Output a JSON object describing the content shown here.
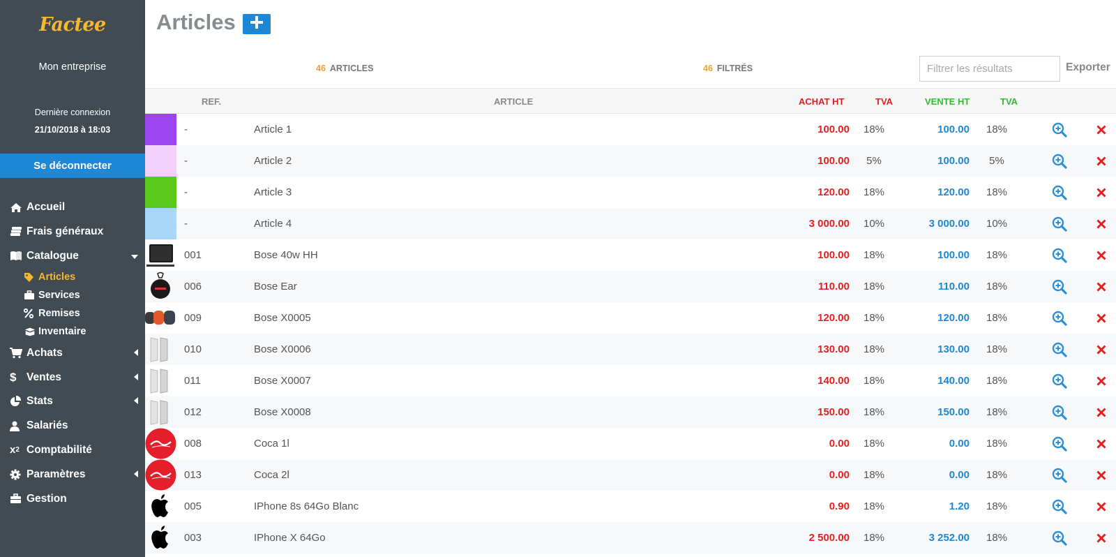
{
  "app": {
    "logo_text": "Factee",
    "company": "Mon entreprise",
    "last_login_label": "Dernière connexion",
    "last_login_date": "21/10/2018 à 18:03",
    "logout_label": "Se déconnecter"
  },
  "nav": {
    "accueil": "Accueil",
    "frais": "Frais généraux",
    "catalogue": "Catalogue",
    "articles": "Articles",
    "services": "Services",
    "remises": "Remises",
    "inventaire": "Inventaire",
    "achats": "Achats",
    "ventes": "Ventes",
    "stats": "Stats",
    "salaries": "Salariés",
    "comptabilite": "Comptabilité",
    "parametres": "Paramètres",
    "gestion": "Gestion"
  },
  "header": {
    "title": "Articles",
    "add_icon": "plus-icon"
  },
  "stats": {
    "articles_count": "46",
    "articles_label": "ARTICLES",
    "filtered_count": "46",
    "filtered_label": "FILTRÉS"
  },
  "filter": {
    "placeholder": "Filtrer les résultats",
    "value": ""
  },
  "export_label": "Exporter",
  "columns": {
    "ref": "REF.",
    "article": "ARTICLE",
    "achat": "ACHAT HT",
    "tva1": "TVA",
    "vente": "VENTE HT",
    "tva2": "TVA"
  },
  "colors": {
    "sidebar": "#424a52",
    "accent": "#1e88d6",
    "brand": "#f5b82e",
    "achat": "#e32020",
    "vente": "#1e88d6",
    "vente_header": "#2cc12c"
  },
  "rows": [
    {
      "thumb": "color",
      "color": "#9b44f0",
      "ref": "-",
      "name": "Article 1",
      "achat": "100.00",
      "tva1": "18%",
      "vente": "100.00",
      "tva2": "18%"
    },
    {
      "thumb": "color",
      "color": "#f2d0fb",
      "ref": "-",
      "name": "Article 2",
      "achat": "100.00",
      "tva1": "5%",
      "vente": "100.00",
      "tva2": "5%"
    },
    {
      "thumb": "color",
      "color": "#5bc81c",
      "ref": "-",
      "name": "Article 3",
      "achat": "120.00",
      "tva1": "18%",
      "vente": "120.00",
      "tva2": "18%"
    },
    {
      "thumb": "color",
      "color": "#aad6f7",
      "ref": "-",
      "name": "Article 4",
      "achat": "3 000.00",
      "tva1": "10%",
      "vente": "3 000.00",
      "tva2": "10%"
    },
    {
      "thumb": "speaker",
      "ref": "001",
      "name": "Bose 40w HH",
      "achat": "100.00",
      "tva1": "18%",
      "vente": "100.00",
      "tva2": "18%"
    },
    {
      "thumb": "ear",
      "ref": "006",
      "name": "Bose Ear",
      "achat": "110.00",
      "tva1": "18%",
      "vente": "110.00",
      "tva2": "18%"
    },
    {
      "thumb": "pods",
      "ref": "009",
      "name": "Bose X0005",
      "achat": "120.00",
      "tva1": "18%",
      "vente": "120.00",
      "tva2": "18%"
    },
    {
      "thumb": "panels",
      "ref": "010",
      "name": "Bose X0006",
      "achat": "130.00",
      "tva1": "18%",
      "vente": "130.00",
      "tva2": "18%"
    },
    {
      "thumb": "panels",
      "ref": "011",
      "name": "Bose X0007",
      "achat": "140.00",
      "tva1": "18%",
      "vente": "140.00",
      "tva2": "18%"
    },
    {
      "thumb": "panels",
      "ref": "012",
      "name": "Bose X0008",
      "achat": "150.00",
      "tva1": "18%",
      "vente": "150.00",
      "tva2": "18%"
    },
    {
      "thumb": "coca",
      "ref": "008",
      "name": "Coca 1l",
      "achat": "0.00",
      "tva1": "18%",
      "vente": "0.00",
      "tva2": "18%"
    },
    {
      "thumb": "coca",
      "ref": "013",
      "name": "Coca 2l",
      "achat": "0.00",
      "tva1": "18%",
      "vente": "0.00",
      "tva2": "18%"
    },
    {
      "thumb": "apple",
      "ref": "005",
      "name": "IPhone 8s 64Go Blanc",
      "achat": "0.90",
      "tva1": "18%",
      "vente": "1.20",
      "tva2": "18%"
    },
    {
      "thumb": "apple",
      "ref": "003",
      "name": "IPhone X 64Go",
      "achat": "2 500.00",
      "tva1": "18%",
      "vente": "3 252.00",
      "tva2": "18%"
    }
  ]
}
